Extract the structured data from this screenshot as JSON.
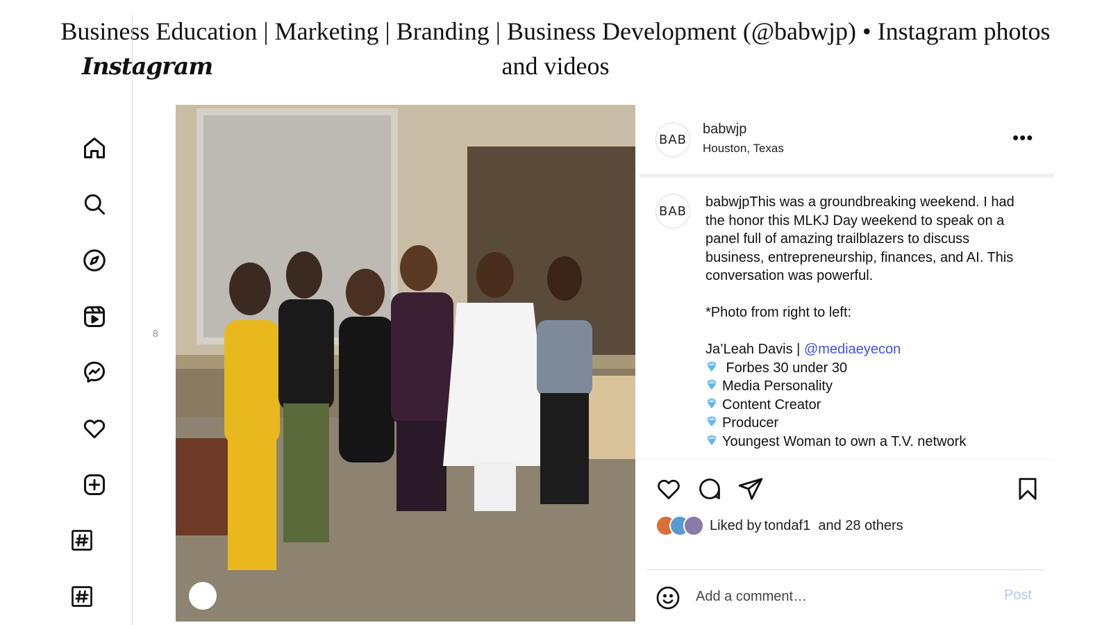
{
  "page_title": "Business Education | Marketing | Branding | Business Development (@babwjp) • Instagram photos and videos",
  "logo_text": "Instagram",
  "nav": {
    "items": [
      {
        "icon": "home-icon"
      },
      {
        "icon": "search-icon"
      },
      {
        "icon": "explore-icon"
      },
      {
        "icon": "reels-icon"
      },
      {
        "icon": "messenger-icon"
      },
      {
        "icon": "heart-icon"
      },
      {
        "icon": "create-icon"
      },
      {
        "icon": "hashtag-icon"
      },
      {
        "icon": "hashtag-icon"
      }
    ],
    "side_marker": "8"
  },
  "post": {
    "avatar_text": "BAB",
    "username": "babwjp",
    "location": "Houston, Texas",
    "more_label": "•••",
    "caption": {
      "username": "babwjp",
      "intro": "This was a groundbreaking weekend. I had the honor this MLKJ Day weekend to speak on a panel full of amazing trailblazers to discuss business, entrepreneurship, finances, and AI. This conversation was powerful.",
      "photo_note": "*Photo from right to left:",
      "person_name": "Ja’Leah Davis | ",
      "person_handle": "@mediaeyecon",
      "bullets": [
        " Forbes 30 under 30",
        "Media Personality",
        "Content Creator",
        "Producer",
        "Youngest Woman to own a T.V. network"
      ]
    },
    "likes": {
      "prefix": "Liked by ",
      "user": "tondaf1",
      "suffix": "  and 28 others"
    },
    "comment": {
      "placeholder": "Add a comment…",
      "post_label": "Post"
    }
  },
  "colors": {
    "accent": "#4150f7",
    "post_disabled": "#b3c8f0",
    "gem": "#5bb8f0"
  }
}
